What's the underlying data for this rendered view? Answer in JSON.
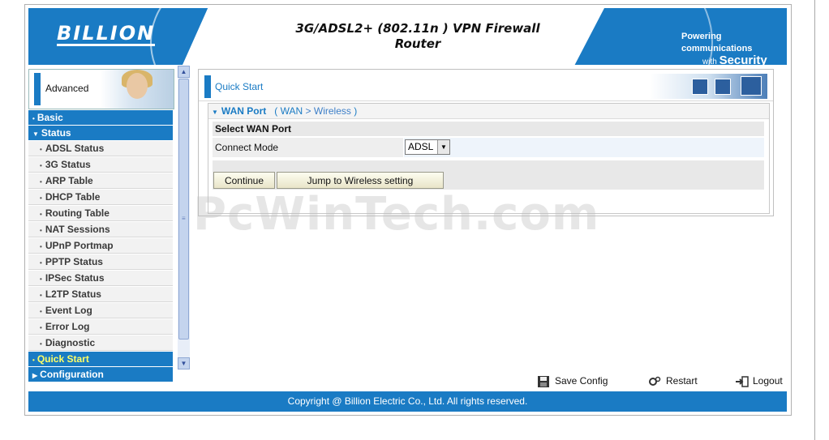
{
  "header": {
    "logo": "BILLION",
    "title_line1": "3G/ADSL2+ (802.11n ) VPN Firewall",
    "title_line2": "Router",
    "tagline_small1": "Powering communications",
    "tagline_small2": "with",
    "tagline_big": "Security"
  },
  "sidebar": {
    "header_label": "Advanced",
    "items": [
      {
        "label": "Basic",
        "type": "main",
        "icon": "bullet"
      },
      {
        "label": "Status",
        "type": "main",
        "icon": "triangle-down"
      },
      {
        "label": "ADSL Status",
        "type": "sub"
      },
      {
        "label": "3G Status",
        "type": "sub"
      },
      {
        "label": "ARP Table",
        "type": "sub"
      },
      {
        "label": "DHCP Table",
        "type": "sub"
      },
      {
        "label": "Routing Table",
        "type": "sub"
      },
      {
        "label": "NAT Sessions",
        "type": "sub"
      },
      {
        "label": "UPnP Portmap",
        "type": "sub"
      },
      {
        "label": "PPTP Status",
        "type": "sub"
      },
      {
        "label": "IPSec Status",
        "type": "sub"
      },
      {
        "label": "L2TP Status",
        "type": "sub"
      },
      {
        "label": "Event Log",
        "type": "sub"
      },
      {
        "label": "Error Log",
        "type": "sub"
      },
      {
        "label": "Diagnostic",
        "type": "sub"
      },
      {
        "label": "Quick Start",
        "type": "main",
        "active": true,
        "icon": "bullet"
      },
      {
        "label": "Configuration",
        "type": "main",
        "icon": "triangle-right"
      }
    ]
  },
  "main": {
    "section_title": "Quick Start",
    "panel": {
      "title": "WAN Port",
      "crumb_open": "(",
      "crumb_wan": "WAN",
      "crumb_sep": ">",
      "crumb_wireless": "Wireless",
      "crumb_close": ")",
      "table_header": "Select WAN Port",
      "connect_mode_label": "Connect Mode",
      "connect_mode_value": "ADSL",
      "continue_button": "Continue",
      "jump_button": "Jump to Wireless setting"
    },
    "watermark": "PcWinTech.com"
  },
  "actions": {
    "save_config": "Save Config",
    "restart": "Restart",
    "logout": "Logout"
  },
  "footer": {
    "copyright": "Copyright @ Billion Electric Co., Ltd. All rights reserved."
  },
  "colors": {
    "brand_blue": "#1a7bc4",
    "active_nav_text": "#ffff66"
  }
}
